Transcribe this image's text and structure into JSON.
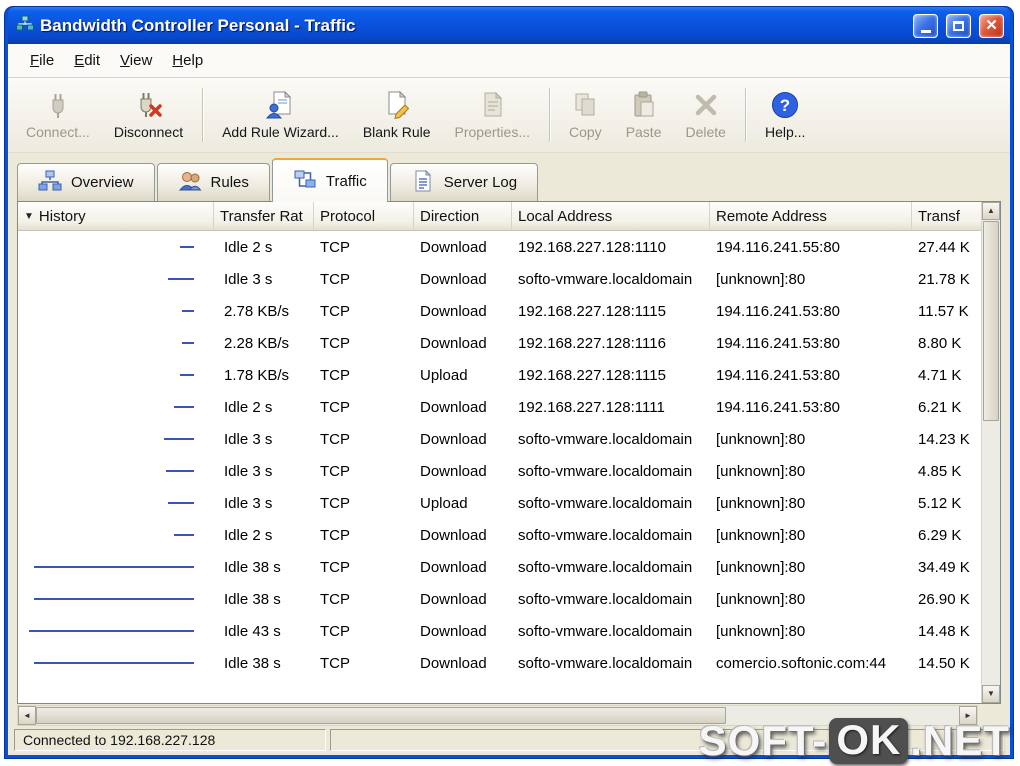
{
  "titlebar": {
    "title": "Bandwidth Controller Personal - Traffic"
  },
  "menubar": {
    "file": "File",
    "edit": "Edit",
    "view": "View",
    "help": "Help"
  },
  "toolbar": {
    "buttons": [
      {
        "label": "Connect...",
        "icon": "connect-icon",
        "enabled": false
      },
      {
        "label": "Disconnect",
        "icon": "disconnect-icon",
        "enabled": true
      },
      {
        "label": "Add Rule Wizard...",
        "icon": "add-rule-wizard-icon",
        "enabled": true
      },
      {
        "label": "Blank Rule",
        "icon": "blank-rule-icon",
        "enabled": true
      },
      {
        "label": "Properties...",
        "icon": "properties-icon",
        "enabled": false
      },
      {
        "label": "Copy",
        "icon": "copy-icon",
        "enabled": false
      },
      {
        "label": "Paste",
        "icon": "paste-icon",
        "enabled": false
      },
      {
        "label": "Delete",
        "icon": "delete-icon",
        "enabled": false
      },
      {
        "label": "Help...",
        "icon": "help-icon",
        "enabled": true
      }
    ]
  },
  "tabs": [
    {
      "label": "Overview",
      "icon": "overview-icon",
      "active": false
    },
    {
      "label": "Rules",
      "icon": "rules-icon",
      "active": false
    },
    {
      "label": "Traffic",
      "icon": "traffic-icon",
      "active": true
    },
    {
      "label": "Server Log",
      "icon": "server-log-icon",
      "active": false
    }
  ],
  "table": {
    "columns": [
      {
        "sort": "▼",
        "label": "History"
      },
      {
        "label": "Transfer Rat"
      },
      {
        "label": "Protocol"
      },
      {
        "label": "Direction"
      },
      {
        "label": "Local Address"
      },
      {
        "label": "Remote Address"
      },
      {
        "label": "Transf"
      }
    ],
    "rows": [
      {
        "spark": 14,
        "rate": "Idle 2 s",
        "protocol": "TCP",
        "direction": "Download",
        "local": "192.168.227.128:1110",
        "remote": "194.116.241.55:80",
        "transferred": "27.44 K"
      },
      {
        "spark": 26,
        "rate": "Idle 3 s",
        "protocol": "TCP",
        "direction": "Download",
        "local": "softo-vmware.localdomain",
        "remote": "[unknown]:80",
        "transferred": "21.78 K"
      },
      {
        "spark": 12,
        "rate": "2.78 KB/s",
        "protocol": "TCP",
        "direction": "Download",
        "local": "192.168.227.128:1115",
        "remote": "194.116.241.53:80",
        "transferred": "11.57 K"
      },
      {
        "spark": 12,
        "rate": "2.28 KB/s",
        "protocol": "TCP",
        "direction": "Download",
        "local": "192.168.227.128:1116",
        "remote": "194.116.241.53:80",
        "transferred": "8.80 K"
      },
      {
        "spark": 14,
        "rate": "1.78 KB/s",
        "protocol": "TCP",
        "direction": "Upload",
        "local": "192.168.227.128:1115",
        "remote": "194.116.241.53:80",
        "transferred": "4.71 K"
      },
      {
        "spark": 20,
        "rate": "Idle 2 s",
        "protocol": "TCP",
        "direction": "Download",
        "local": "192.168.227.128:1111",
        "remote": "194.116.241.53:80",
        "transferred": "6.21 K"
      },
      {
        "spark": 30,
        "rate": "Idle 3 s",
        "protocol": "TCP",
        "direction": "Download",
        "local": "softo-vmware.localdomain",
        "remote": "[unknown]:80",
        "transferred": "14.23 K"
      },
      {
        "spark": 28,
        "rate": "Idle 3 s",
        "protocol": "TCP",
        "direction": "Download",
        "local": "softo-vmware.localdomain",
        "remote": "[unknown]:80",
        "transferred": "4.85 K"
      },
      {
        "spark": 26,
        "rate": "Idle 3 s",
        "protocol": "TCP",
        "direction": "Upload",
        "local": "softo-vmware.localdomain",
        "remote": "[unknown]:80",
        "transferred": "5.12 K"
      },
      {
        "spark": 20,
        "rate": "Idle 2 s",
        "protocol": "TCP",
        "direction": "Download",
        "local": "softo-vmware.localdomain",
        "remote": "[unknown]:80",
        "transferred": "6.29 K"
      },
      {
        "spark": 160,
        "rate": "Idle 38 s",
        "protocol": "TCP",
        "direction": "Download",
        "local": "softo-vmware.localdomain",
        "remote": "[unknown]:80",
        "transferred": "34.49 K"
      },
      {
        "spark": 160,
        "rate": "Idle 38 s",
        "protocol": "TCP",
        "direction": "Download",
        "local": "softo-vmware.localdomain",
        "remote": "[unknown]:80",
        "transferred": "26.90 K"
      },
      {
        "spark": 165,
        "rate": "Idle 43 s",
        "protocol": "TCP",
        "direction": "Download",
        "local": "softo-vmware.localdomain",
        "remote": "[unknown]:80",
        "transferred": "14.48 K"
      },
      {
        "spark": 160,
        "rate": "Idle 38 s",
        "protocol": "TCP",
        "direction": "Download",
        "local": "softo-vmware.localdomain",
        "remote": "comercio.softonic.com:44",
        "transferred": "14.50 K"
      }
    ]
  },
  "statusbar": {
    "text": "Connected to 192.168.227.128"
  },
  "watermark": {
    "prefix": "SOFT-",
    "badge": "OK",
    "suffix": ".NET"
  },
  "colors": {
    "titlebar_blue": "#0A53DF",
    "spark_blue": "#3A55B8",
    "close_red": "#C23318",
    "chrome_face": "#ECE9D8"
  }
}
